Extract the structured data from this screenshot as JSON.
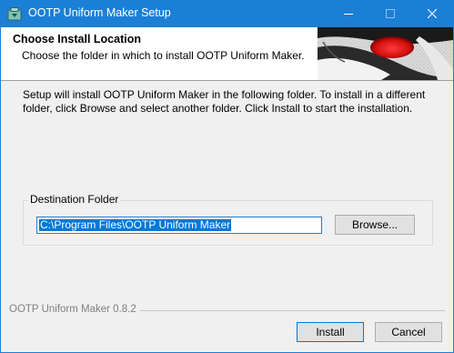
{
  "window": {
    "title": "OOTP Uniform Maker Setup",
    "app_icon": "installer-icon",
    "controls": [
      "minimize-icon",
      "maximize-icon",
      "close-icon"
    ]
  },
  "header": {
    "title": "Choose Install Location",
    "subtitle": "Choose the folder in which to install OOTP Uniform Maker."
  },
  "body": {
    "intro": "Setup will install OOTP Uniform Maker in the following folder. To install in a different folder, click Browse and select another folder. Click Install to start the installation."
  },
  "destination": {
    "group_label": "Destination Folder",
    "path": "C:\\Program Files\\OOTP Uniform Maker",
    "browse_label": "Browse..."
  },
  "footer": {
    "brand": "OOTP Uniform Maker 0.8.2",
    "install_label": "Install",
    "cancel_label": "Cancel"
  },
  "colors": {
    "titlebar": "#1c7fd6",
    "selection": "#0078d7",
    "button_face": "#e1e1e1"
  }
}
